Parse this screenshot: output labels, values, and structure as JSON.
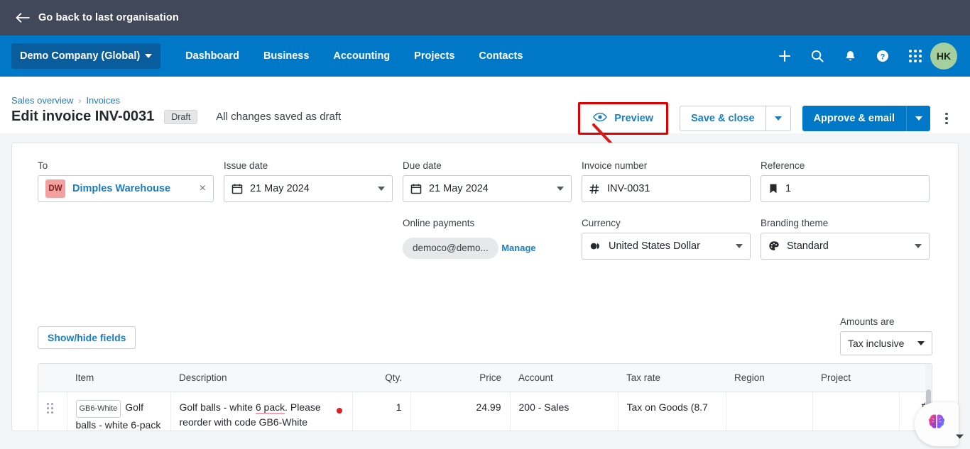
{
  "org_bar": {
    "back_label": "Go back to last organisation",
    "back_icon": "arrow-left-icon",
    "bg_color": "#41485a"
  },
  "nav": {
    "org_name": "Demo Company (Global)",
    "links": [
      {
        "label": "Dashboard"
      },
      {
        "label": "Business"
      },
      {
        "label": "Accounting"
      },
      {
        "label": "Projects"
      },
      {
        "label": "Contacts"
      }
    ],
    "icons": [
      {
        "name": "plus-icon"
      },
      {
        "name": "search-icon"
      },
      {
        "name": "bell-icon"
      },
      {
        "name": "help-icon"
      },
      {
        "name": "apps-grid-icon"
      }
    ],
    "avatar_initials": "HK",
    "bg_color": "#0078c8",
    "avatar_color": "#a5cf9e"
  },
  "header": {
    "breadcrumb": {
      "root": "Sales overview",
      "separator": "›",
      "current": "Invoices"
    },
    "title": "Edit invoice INV-0031",
    "status_badge": "Draft",
    "save_status": "All changes saved as draft",
    "actions": {
      "preview": "Preview",
      "save_close": "Save & close",
      "approve_email": "Approve & email",
      "more_menu": "kebab-menu-icon"
    },
    "annotation": {
      "highlight_color": "#e00000",
      "arrow_color": "#d81b1b",
      "target": "Preview"
    }
  },
  "form": {
    "to": {
      "label": "To",
      "chip_initials": "DW",
      "value": "Dimples Warehouse",
      "clear": "×"
    },
    "issue_date": {
      "label": "Issue date",
      "value": "21 May 2024",
      "icon": "calendar-icon"
    },
    "due_date": {
      "label": "Due date",
      "value": "21 May 2024",
      "icon": "calendar-icon"
    },
    "invoice_number": {
      "label": "Invoice number",
      "value": "INV-0031",
      "icon": "hash-icon"
    },
    "reference": {
      "label": "Reference",
      "value": "1",
      "icon": "bookmark-icon"
    },
    "online_payments": {
      "label": "Online payments",
      "chip": "democo@demo...",
      "manage_link": "Manage"
    },
    "currency": {
      "label": "Currency",
      "value": "United States Dollar",
      "icon": "currency-icon"
    },
    "branding_theme": {
      "label": "Branding theme",
      "value": "Standard",
      "icon": "palette-icon"
    },
    "show_hide_fields": "Show/hide fields",
    "amounts_are": {
      "label": "Amounts are",
      "value": "Tax inclusive"
    }
  },
  "line_items": {
    "columns": [
      "Item",
      "Description",
      "Qty.",
      "Price",
      "Account",
      "Tax rate",
      "Region",
      "Project"
    ],
    "rows": [
      {
        "drag": "drag-handle-icon",
        "item_code": "GB6-White",
        "item_name": "Golf balls - white 6-pack",
        "description": "Golf balls - white 6 pack. Please reorder with code GB6-White",
        "description_spellcheck_word": "6 pack",
        "qty": "1",
        "price": "24.99",
        "account": "200 - Sales",
        "tax_rate": "Tax on Goods (8.7",
        "region": "",
        "project": "",
        "delete": "trash-icon"
      }
    ]
  },
  "ai_widget": {
    "name": "brain-assistant-icon"
  }
}
